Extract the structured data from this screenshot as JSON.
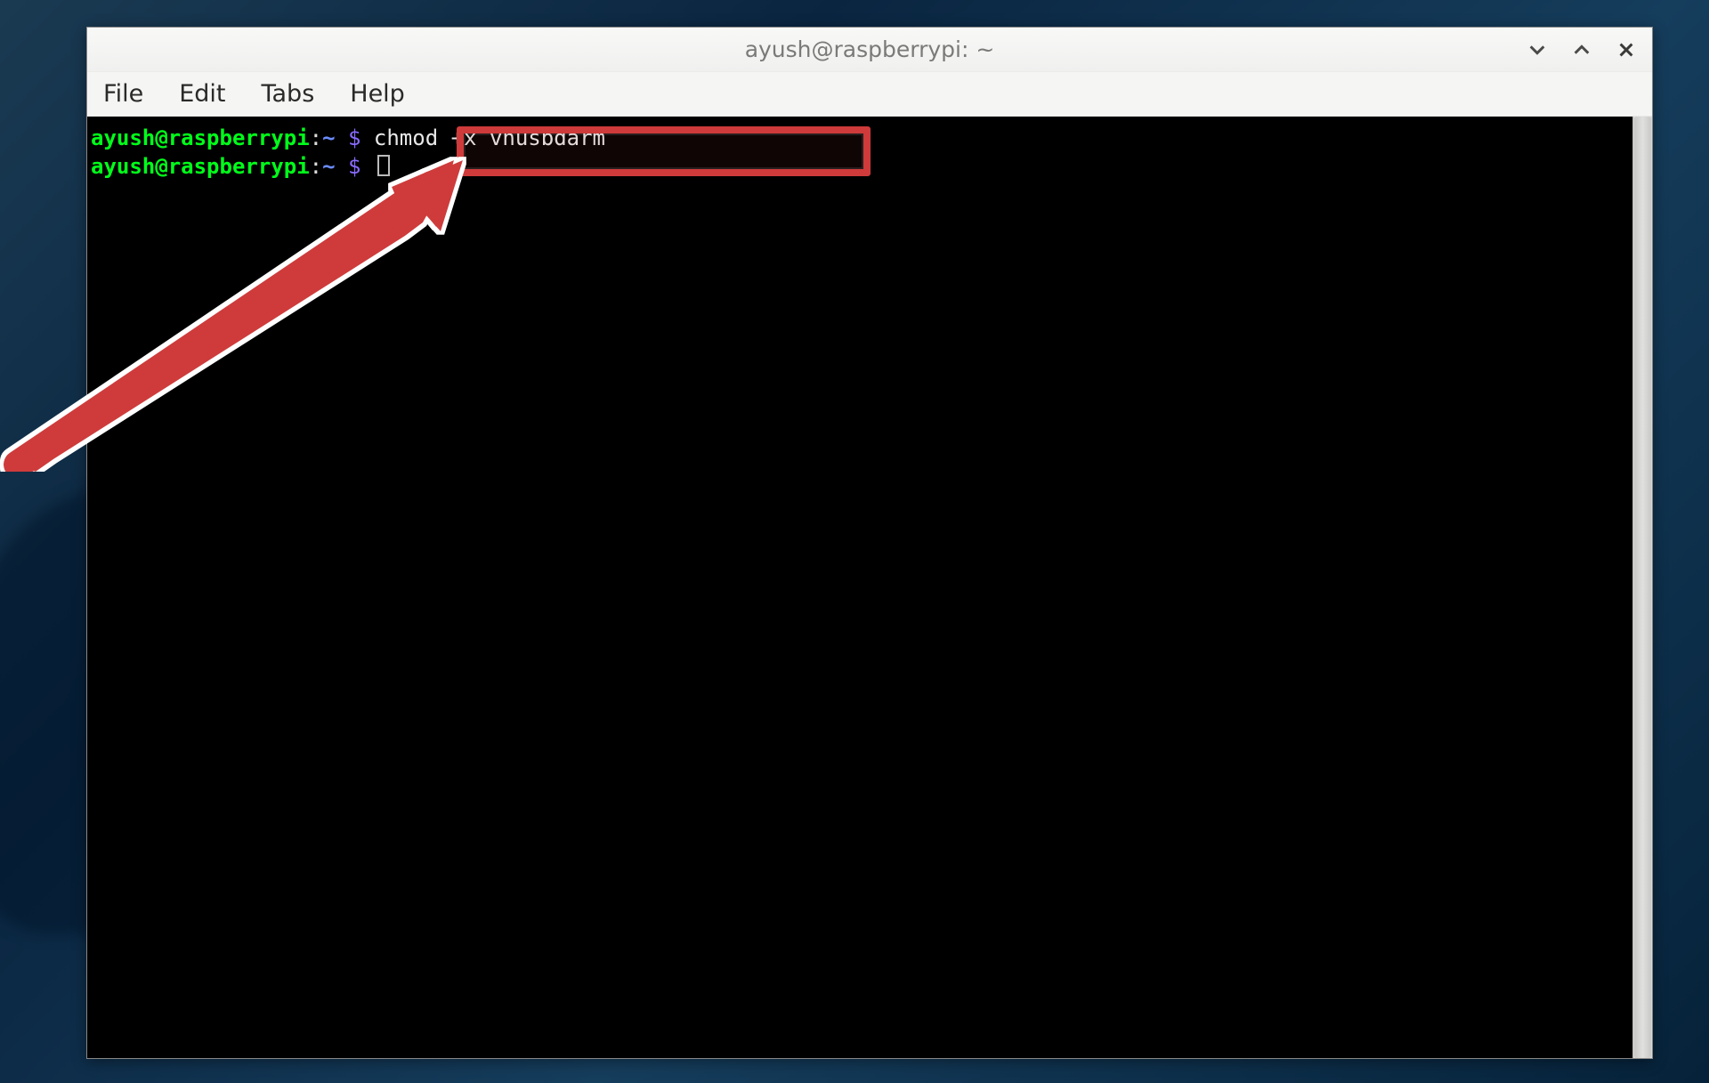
{
  "window": {
    "title": "ayush@raspberrypi: ~"
  },
  "menu": {
    "file": "File",
    "edit": "Edit",
    "tabs": "Tabs",
    "help": "Help"
  },
  "terminal": {
    "lines": [
      {
        "user_host": "ayush@raspberrypi",
        "colon": ":",
        "path": "~",
        "dollar": " $ ",
        "command": "chmod +x vhusbdarm"
      },
      {
        "user_host": "ayush@raspberrypi",
        "colon": ":",
        "path": "~",
        "dollar": " $ ",
        "command": ""
      }
    ]
  },
  "colors": {
    "prompt_green": "#00ff1a",
    "prompt_blue": "#6b8cff",
    "highlight_red": "#cf3a3a",
    "terminal_bg": "#000000"
  }
}
